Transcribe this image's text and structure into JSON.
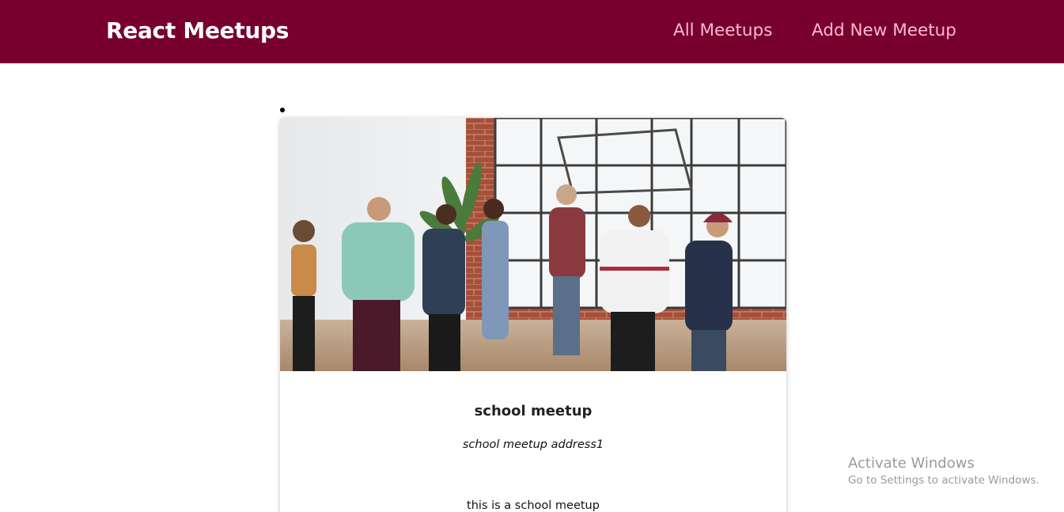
{
  "header": {
    "logo": "React Meetups",
    "nav": [
      {
        "label": "All Meetups"
      },
      {
        "label": "Add New Meetup"
      }
    ]
  },
  "meetups": [
    {
      "title": "school meetup",
      "address": "school meetup address1",
      "description": "this is a school meetup",
      "image_alt": "school meetup"
    }
  ],
  "activation": {
    "title": "Activate Windows",
    "subtitle": "Go to Settings to activate Windows."
  },
  "colors": {
    "header_bg": "#77002e",
    "nav_link": "#fcb8d2",
    "logo": "#ffffff"
  }
}
